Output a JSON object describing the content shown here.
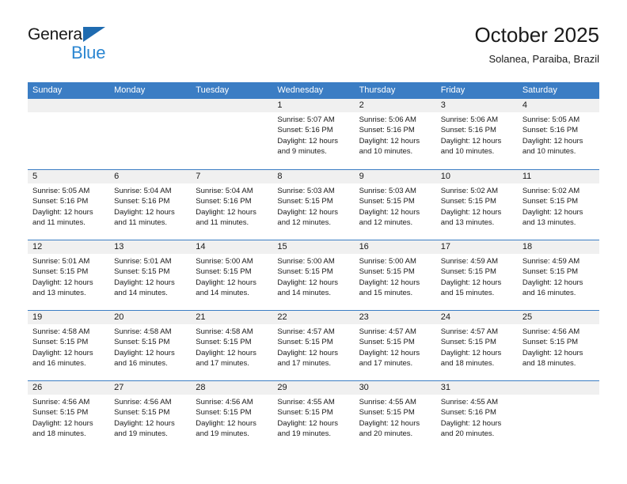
{
  "logo": {
    "primary_text": "General",
    "secondary_text": "Blue",
    "triangle_icon": "triangle-icon",
    "brand_blue": "#2b86d1",
    "brand_dark": "#1a1a1a"
  },
  "header": {
    "month_title": "October 2025",
    "location": "Solanea, Paraiba, Brazil"
  },
  "calendar": {
    "header_bg": "#3b7dc4",
    "day_band_bg": "#f0f0f0",
    "weekdays": [
      "Sunday",
      "Monday",
      "Tuesday",
      "Wednesday",
      "Thursday",
      "Friday",
      "Saturday"
    ],
    "weeks": [
      [
        {
          "day": "",
          "empty": true,
          "sunrise": "",
          "sunset": "",
          "daylight_line1": "",
          "daylight_line2": ""
        },
        {
          "day": "",
          "empty": true,
          "sunrise": "",
          "sunset": "",
          "daylight_line1": "",
          "daylight_line2": ""
        },
        {
          "day": "",
          "empty": true,
          "sunrise": "",
          "sunset": "",
          "daylight_line1": "",
          "daylight_line2": ""
        },
        {
          "day": "1",
          "sunrise": "Sunrise: 5:07 AM",
          "sunset": "Sunset: 5:16 PM",
          "daylight_line1": "Daylight: 12 hours",
          "daylight_line2": "and 9 minutes."
        },
        {
          "day": "2",
          "sunrise": "Sunrise: 5:06 AM",
          "sunset": "Sunset: 5:16 PM",
          "daylight_line1": "Daylight: 12 hours",
          "daylight_line2": "and 10 minutes."
        },
        {
          "day": "3",
          "sunrise": "Sunrise: 5:06 AM",
          "sunset": "Sunset: 5:16 PM",
          "daylight_line1": "Daylight: 12 hours",
          "daylight_line2": "and 10 minutes."
        },
        {
          "day": "4",
          "sunrise": "Sunrise: 5:05 AM",
          "sunset": "Sunset: 5:16 PM",
          "daylight_line1": "Daylight: 12 hours",
          "daylight_line2": "and 10 minutes."
        }
      ],
      [
        {
          "day": "5",
          "sunrise": "Sunrise: 5:05 AM",
          "sunset": "Sunset: 5:16 PM",
          "daylight_line1": "Daylight: 12 hours",
          "daylight_line2": "and 11 minutes."
        },
        {
          "day": "6",
          "sunrise": "Sunrise: 5:04 AM",
          "sunset": "Sunset: 5:16 PM",
          "daylight_line1": "Daylight: 12 hours",
          "daylight_line2": "and 11 minutes."
        },
        {
          "day": "7",
          "sunrise": "Sunrise: 5:04 AM",
          "sunset": "Sunset: 5:16 PM",
          "daylight_line1": "Daylight: 12 hours",
          "daylight_line2": "and 11 minutes."
        },
        {
          "day": "8",
          "sunrise": "Sunrise: 5:03 AM",
          "sunset": "Sunset: 5:15 PM",
          "daylight_line1": "Daylight: 12 hours",
          "daylight_line2": "and 12 minutes."
        },
        {
          "day": "9",
          "sunrise": "Sunrise: 5:03 AM",
          "sunset": "Sunset: 5:15 PM",
          "daylight_line1": "Daylight: 12 hours",
          "daylight_line2": "and 12 minutes."
        },
        {
          "day": "10",
          "sunrise": "Sunrise: 5:02 AM",
          "sunset": "Sunset: 5:15 PM",
          "daylight_line1": "Daylight: 12 hours",
          "daylight_line2": "and 13 minutes."
        },
        {
          "day": "11",
          "sunrise": "Sunrise: 5:02 AM",
          "sunset": "Sunset: 5:15 PM",
          "daylight_line1": "Daylight: 12 hours",
          "daylight_line2": "and 13 minutes."
        }
      ],
      [
        {
          "day": "12",
          "sunrise": "Sunrise: 5:01 AM",
          "sunset": "Sunset: 5:15 PM",
          "daylight_line1": "Daylight: 12 hours",
          "daylight_line2": "and 13 minutes."
        },
        {
          "day": "13",
          "sunrise": "Sunrise: 5:01 AM",
          "sunset": "Sunset: 5:15 PM",
          "daylight_line1": "Daylight: 12 hours",
          "daylight_line2": "and 14 minutes."
        },
        {
          "day": "14",
          "sunrise": "Sunrise: 5:00 AM",
          "sunset": "Sunset: 5:15 PM",
          "daylight_line1": "Daylight: 12 hours",
          "daylight_line2": "and 14 minutes."
        },
        {
          "day": "15",
          "sunrise": "Sunrise: 5:00 AM",
          "sunset": "Sunset: 5:15 PM",
          "daylight_line1": "Daylight: 12 hours",
          "daylight_line2": "and 14 minutes."
        },
        {
          "day": "16",
          "sunrise": "Sunrise: 5:00 AM",
          "sunset": "Sunset: 5:15 PM",
          "daylight_line1": "Daylight: 12 hours",
          "daylight_line2": "and 15 minutes."
        },
        {
          "day": "17",
          "sunrise": "Sunrise: 4:59 AM",
          "sunset": "Sunset: 5:15 PM",
          "daylight_line1": "Daylight: 12 hours",
          "daylight_line2": "and 15 minutes."
        },
        {
          "day": "18",
          "sunrise": "Sunrise: 4:59 AM",
          "sunset": "Sunset: 5:15 PM",
          "daylight_line1": "Daylight: 12 hours",
          "daylight_line2": "and 16 minutes."
        }
      ],
      [
        {
          "day": "19",
          "sunrise": "Sunrise: 4:58 AM",
          "sunset": "Sunset: 5:15 PM",
          "daylight_line1": "Daylight: 12 hours",
          "daylight_line2": "and 16 minutes."
        },
        {
          "day": "20",
          "sunrise": "Sunrise: 4:58 AM",
          "sunset": "Sunset: 5:15 PM",
          "daylight_line1": "Daylight: 12 hours",
          "daylight_line2": "and 16 minutes."
        },
        {
          "day": "21",
          "sunrise": "Sunrise: 4:58 AM",
          "sunset": "Sunset: 5:15 PM",
          "daylight_line1": "Daylight: 12 hours",
          "daylight_line2": "and 17 minutes."
        },
        {
          "day": "22",
          "sunrise": "Sunrise: 4:57 AM",
          "sunset": "Sunset: 5:15 PM",
          "daylight_line1": "Daylight: 12 hours",
          "daylight_line2": "and 17 minutes."
        },
        {
          "day": "23",
          "sunrise": "Sunrise: 4:57 AM",
          "sunset": "Sunset: 5:15 PM",
          "daylight_line1": "Daylight: 12 hours",
          "daylight_line2": "and 17 minutes."
        },
        {
          "day": "24",
          "sunrise": "Sunrise: 4:57 AM",
          "sunset": "Sunset: 5:15 PM",
          "daylight_line1": "Daylight: 12 hours",
          "daylight_line2": "and 18 minutes."
        },
        {
          "day": "25",
          "sunrise": "Sunrise: 4:56 AM",
          "sunset": "Sunset: 5:15 PM",
          "daylight_line1": "Daylight: 12 hours",
          "daylight_line2": "and 18 minutes."
        }
      ],
      [
        {
          "day": "26",
          "sunrise": "Sunrise: 4:56 AM",
          "sunset": "Sunset: 5:15 PM",
          "daylight_line1": "Daylight: 12 hours",
          "daylight_line2": "and 18 minutes."
        },
        {
          "day": "27",
          "sunrise": "Sunrise: 4:56 AM",
          "sunset": "Sunset: 5:15 PM",
          "daylight_line1": "Daylight: 12 hours",
          "daylight_line2": "and 19 minutes."
        },
        {
          "day": "28",
          "sunrise": "Sunrise: 4:56 AM",
          "sunset": "Sunset: 5:15 PM",
          "daylight_line1": "Daylight: 12 hours",
          "daylight_line2": "and 19 minutes."
        },
        {
          "day": "29",
          "sunrise": "Sunrise: 4:55 AM",
          "sunset": "Sunset: 5:15 PM",
          "daylight_line1": "Daylight: 12 hours",
          "daylight_line2": "and 19 minutes."
        },
        {
          "day": "30",
          "sunrise": "Sunrise: 4:55 AM",
          "sunset": "Sunset: 5:15 PM",
          "daylight_line1": "Daylight: 12 hours",
          "daylight_line2": "and 20 minutes."
        },
        {
          "day": "31",
          "sunrise": "Sunrise: 4:55 AM",
          "sunset": "Sunset: 5:16 PM",
          "daylight_line1": "Daylight: 12 hours",
          "daylight_line2": "and 20 minutes."
        },
        {
          "day": "",
          "empty": true,
          "sunrise": "",
          "sunset": "",
          "daylight_line1": "",
          "daylight_line2": ""
        }
      ]
    ]
  }
}
